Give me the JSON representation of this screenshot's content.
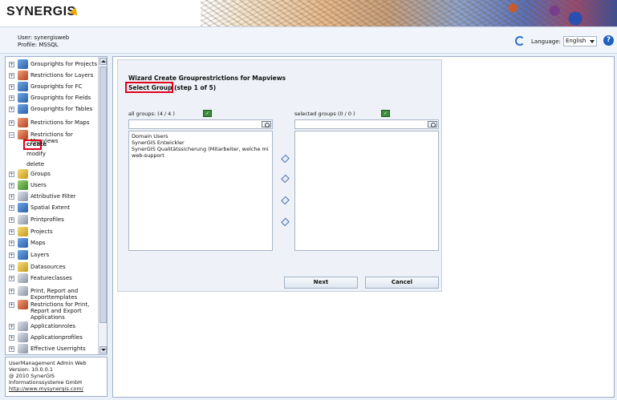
{
  "app": {
    "logo_text": "SYNERGIS"
  },
  "header": {
    "user_label": "User: synergisweb",
    "profile_label": "Profile: MSSQL",
    "language_label": "Language:",
    "language_value": "English"
  },
  "sidebar": {
    "items": [
      {
        "label": "Grouprights for Projects",
        "icon": "group-rights-icon",
        "expand": "+"
      },
      {
        "label": "Restrictions for Layers",
        "icon": "restrictions-icon",
        "expand": "+"
      },
      {
        "label": "Grouprights for FC",
        "icon": "group-rights-icon",
        "expand": "+"
      },
      {
        "label": "Grouprights for Fields",
        "icon": "group-rights-icon",
        "expand": "+"
      },
      {
        "label": "Grouprights for Tables",
        "icon": "group-rights-icon",
        "expand": "+"
      },
      {
        "label": "Restrictions for Maps",
        "icon": "restrictions-icon",
        "expand": "+"
      },
      {
        "label": "Restrictions for Mapviews",
        "icon": "restrictions-icon",
        "expand": "−"
      },
      {
        "label": "Groups",
        "icon": "groups-icon",
        "expand": "+"
      },
      {
        "label": "Users",
        "icon": "users-icon",
        "expand": "+"
      },
      {
        "label": "Attributive Filter",
        "icon": "filter-icon",
        "expand": "+"
      },
      {
        "label": "Spatial Extent",
        "icon": "extent-icon",
        "expand": "+"
      },
      {
        "label": "Printprofiles",
        "icon": "print-icon",
        "expand": "+"
      },
      {
        "label": "Projects",
        "icon": "projects-icon",
        "expand": "+"
      },
      {
        "label": "Maps",
        "icon": "maps-icon",
        "expand": "+"
      },
      {
        "label": "Layers",
        "icon": "layers-icon",
        "expand": "+"
      },
      {
        "label": "Datasources",
        "icon": "datasource-icon",
        "expand": "+"
      },
      {
        "label": "Featureclasses",
        "icon": "featureclass-icon",
        "expand": "+"
      },
      {
        "label": "Print, Report and Exporttemplates",
        "icon": "template-icon",
        "expand": "+"
      },
      {
        "label": "Restrictions for Print, Report and Export Applications",
        "icon": "restrictions-icon",
        "expand": "+"
      },
      {
        "label": "Applicationroles",
        "icon": "role-icon",
        "expand": "+"
      },
      {
        "label": "Applicationprofiles",
        "icon": "profile-icon",
        "expand": "+"
      },
      {
        "label": "Effective Userrights",
        "icon": "rights-icon",
        "expand": "+"
      }
    ],
    "sub_items": {
      "create": "create",
      "modify": "modify",
      "delete": "delete"
    }
  },
  "footer": {
    "line1": "UserManagement Admin Web",
    "line2": "Version: 10.0.0.1",
    "line3": "@ 2010 SynerGIS",
    "line4": "Informationssysteme GmbH",
    "link": "http://www.mysynergis.com/"
  },
  "wizard": {
    "title": "Wizard Create Grouprestrictions for Mapviews",
    "step": "Select Group (step 1 of 5)",
    "all_groups_label": "all groups: (4    /  4    )",
    "selected_groups_label": "selected groups (0    /  0    )",
    "all_groups": [
      "Domain Users",
      "SynerGIS Entwickler",
      "SynerGIS Qualitätssicherung (Mitarbeiter, welche mi",
      "web-support"
    ],
    "next_label": "Next",
    "cancel_label": "Cancel"
  },
  "colors": {
    "highlight": "#e0001b",
    "accent": "#1f5fc0"
  }
}
